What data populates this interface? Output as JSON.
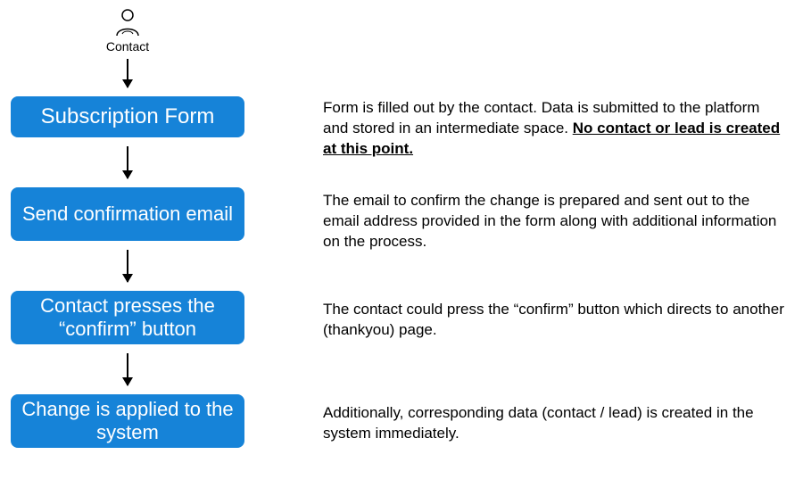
{
  "actor": {
    "label": "Contact"
  },
  "steps": [
    {
      "title": "Subscription Form",
      "desc_pre": "Form is filled out by the contact. Data is submitted to the platform and stored in an intermediate space. ",
      "desc_emph": "No contact or lead is created at this point.",
      "desc_post": ""
    },
    {
      "title": "Send confirmation email",
      "desc_pre": "The email to confirm the change is prepared and sent out to the email address provided in the form along with additional information on the process.",
      "desc_emph": "",
      "desc_post": ""
    },
    {
      "title": "Contact presses the “confirm” button",
      "desc_pre": "The contact could press the “confirm” button which directs to another (thankyou) page.",
      "desc_emph": "",
      "desc_post": ""
    },
    {
      "title": "Change is applied to the system",
      "desc_pre": "Additionally, corresponding data (contact / lead) is created in the system immediately.",
      "desc_emph": "",
      "desc_post": ""
    }
  ]
}
